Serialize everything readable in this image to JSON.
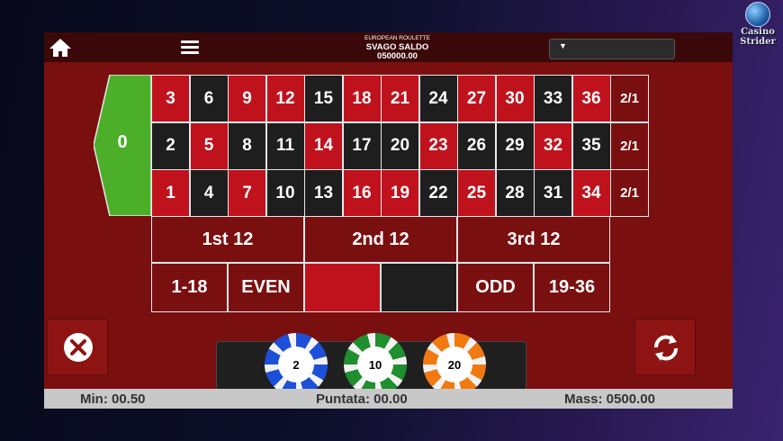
{
  "brand": {
    "line1": "Casino",
    "line2": "Strider"
  },
  "header": {
    "game_name": "EUROPEAN ROULETTE",
    "player_label": "SVAGO SALDO",
    "balance": "050000.00"
  },
  "table": {
    "zero": "0",
    "top_row": [
      {
        "n": "3",
        "c": "red"
      },
      {
        "n": "6",
        "c": "blk"
      },
      {
        "n": "9",
        "c": "red"
      },
      {
        "n": "12",
        "c": "red"
      },
      {
        "n": "15",
        "c": "blk"
      },
      {
        "n": "18",
        "c": "red"
      },
      {
        "n": "21",
        "c": "red"
      },
      {
        "n": "24",
        "c": "blk"
      },
      {
        "n": "27",
        "c": "red"
      },
      {
        "n": "30",
        "c": "red"
      },
      {
        "n": "33",
        "c": "blk"
      },
      {
        "n": "36",
        "c": "red"
      }
    ],
    "middle_row": [
      {
        "n": "2",
        "c": "blk"
      },
      {
        "n": "5",
        "c": "red"
      },
      {
        "n": "8",
        "c": "blk"
      },
      {
        "n": "11",
        "c": "blk"
      },
      {
        "n": "14",
        "c": "red"
      },
      {
        "n": "17",
        "c": "blk"
      },
      {
        "n": "20",
        "c": "blk"
      },
      {
        "n": "23",
        "c": "red"
      },
      {
        "n": "26",
        "c": "blk"
      },
      {
        "n": "29",
        "c": "blk"
      },
      {
        "n": "32",
        "c": "red"
      },
      {
        "n": "35",
        "c": "blk"
      }
    ],
    "bottom_row": [
      {
        "n": "1",
        "c": "red"
      },
      {
        "n": "4",
        "c": "blk"
      },
      {
        "n": "7",
        "c": "red"
      },
      {
        "n": "10",
        "c": "blk"
      },
      {
        "n": "13",
        "c": "blk"
      },
      {
        "n": "16",
        "c": "red"
      },
      {
        "n": "19",
        "c": "red"
      },
      {
        "n": "22",
        "c": "blk"
      },
      {
        "n": "25",
        "c": "red"
      },
      {
        "n": "28",
        "c": "blk"
      },
      {
        "n": "31",
        "c": "blk"
      },
      {
        "n": "34",
        "c": "red"
      }
    ],
    "column_bets": [
      "2/1",
      "2/1",
      "2/1"
    ],
    "dozens": [
      "1st 12",
      "2nd 12",
      "3rd 12"
    ],
    "even_money": {
      "low": "1-18",
      "even": "EVEN",
      "odd": "ODD",
      "high": "19-36"
    }
  },
  "chips": [
    {
      "value": "2",
      "color": "#1d4fd8"
    },
    {
      "value": "10",
      "color": "#1f8f2f"
    },
    {
      "value": "20",
      "color": "#f07a10"
    }
  ],
  "status": {
    "min": "Min: 00.50",
    "bet": "Puntata: 00.00",
    "max": "Mass: 0500.00"
  },
  "colors": {
    "felt": "#7a0f0f",
    "red": "#c0121d",
    "black": "#1e1e1e",
    "zero": "#4caf2a"
  }
}
